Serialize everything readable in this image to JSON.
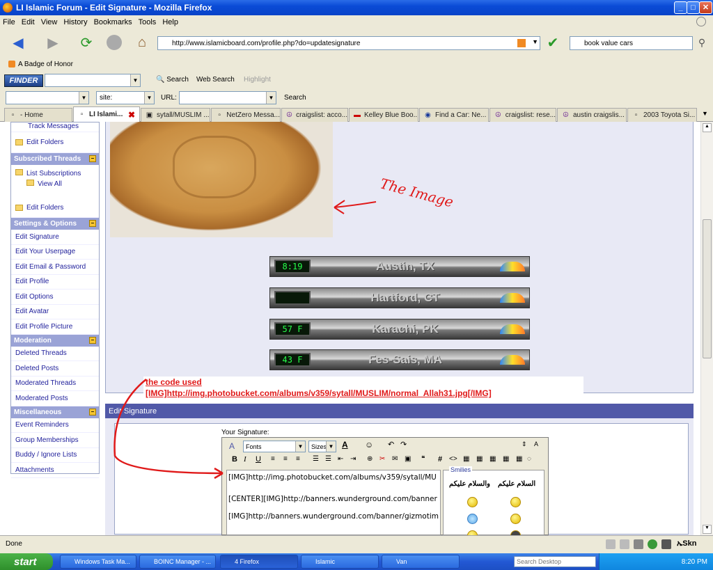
{
  "window": {
    "title": "LI Islamic Forum - Edit Signature - Mozilla Firefox"
  },
  "menu": [
    "File",
    "Edit",
    "View",
    "History",
    "Bookmarks",
    "Tools",
    "Help"
  ],
  "nav": {
    "url": "http://www.islamicboard.com/profile.php?do=updatesignature",
    "search_value": "book value cars"
  },
  "bookmarks": [
    "A Badge of Honor"
  ],
  "finder": {
    "logo": "FINDER",
    "search_label": "Search",
    "web_search_label": "Web Search",
    "highlight_label": "Highlight"
  },
  "siterow": {
    "site_value": "site:",
    "url_label": "URL:",
    "search_button": "Search"
  },
  "tabs": [
    "- Home",
    "LI Islami...",
    "sytall/MUSLIM ...",
    "NetZero Messa...",
    "craigslist: acco...",
    "Kelley Blue Boo...",
    "Find a Car: Ne...",
    "craigslist: rese...",
    "austin craigslis...",
    "2003 Toyota Si..."
  ],
  "sidebar": {
    "items_top": [
      "Track Messages",
      "Edit Folders"
    ],
    "subscribed_head": "Subscribed Threads",
    "subscribed": [
      "List Subscriptions",
      "View All",
      "Edit Folders"
    ],
    "settings_head": "Settings & Options",
    "settings": [
      "Edit Signature",
      "Edit Your Userpage",
      "Edit Email & Password",
      "Edit Profile",
      "Edit Options",
      "Edit Avatar",
      "Edit Profile Picture"
    ],
    "moderation_head": "Moderation",
    "moderation": [
      "Deleted Threads",
      "Deleted Posts",
      "Moderated Threads",
      "Moderated Posts"
    ],
    "misc_head": "Miscellaneous",
    "misc": [
      "Event Reminders",
      "Group Memberships",
      "Buddy / Ignore Lists",
      "Attachments"
    ]
  },
  "annotation": {
    "image_label": "The Image"
  },
  "weather": [
    {
      "clock": "8:19",
      "city": "Austin, TX"
    },
    {
      "clock": "",
      "city": "Hartford, CT"
    },
    {
      "clock": "57 F",
      "city": "Karachi, PK"
    },
    {
      "clock": "43 F",
      "city": "Fes-Sais, MA"
    }
  ],
  "code_note": {
    "line1": "the code used",
    "line2": "[IMG]http://img.photobucket.com/albums/v359/sytall/MUSLIM/normal_Allah31.jpg[/IMG]"
  },
  "edit": {
    "header": "Edit Signature",
    "your_signature": "Your Signature:",
    "font_select": "Fonts",
    "size_select": "Sizes",
    "lines": [
      "[IMG]http://img.photobucket.com/albums/v359/sytall/MU",
      "",
      "[CENTER][IMG]http://banners.wunderground.com/banner",
      "[IMG]http://banners.wunderground.com/banner/gizmotim"
    ],
    "smilies_title": "Smilies",
    "arabic1": "السلام عليكم",
    "arabic2": "والسلام عليكم"
  },
  "status": {
    "text": "Done"
  },
  "taskbar": {
    "start": "start",
    "tasks": [
      "Windows Task Ma...",
      "BOINC Manager - ...",
      "4 Firefox",
      "Islamic",
      "Van"
    ],
    "search_placeholder": "Search Desktop",
    "time": "8:20 PM"
  },
  "colors": {
    "title_blue": "#0a4bd6",
    "forum_purple": "#5159a8",
    "annotation_red": "#e01a1a"
  }
}
